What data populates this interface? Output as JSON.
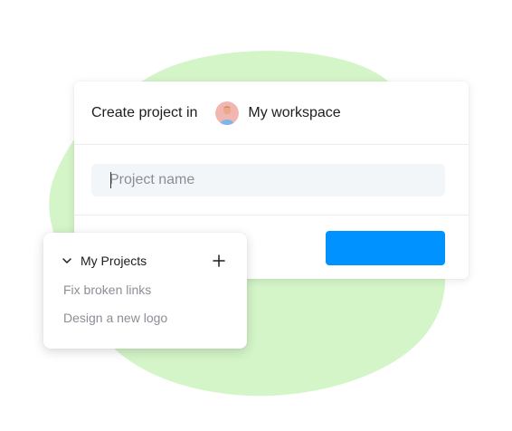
{
  "colors": {
    "blob": "#d4f5c8",
    "accent": "#0093ff",
    "input_bg": "#f3f6f8",
    "muted_text": "#8a8f96"
  },
  "create_dialog": {
    "title": "Create project in",
    "workspace_name": "My workspace",
    "avatar_icon": "user-avatar",
    "name_input": {
      "value": "",
      "placeholder": "Project name"
    },
    "create_button_label": ""
  },
  "projects_panel": {
    "title": "My Projects",
    "collapse_icon": "chevron-down-icon",
    "add_icon": "plus-icon",
    "items": [
      {
        "label": "Fix broken links"
      },
      {
        "label": "Design a new logo"
      }
    ]
  }
}
